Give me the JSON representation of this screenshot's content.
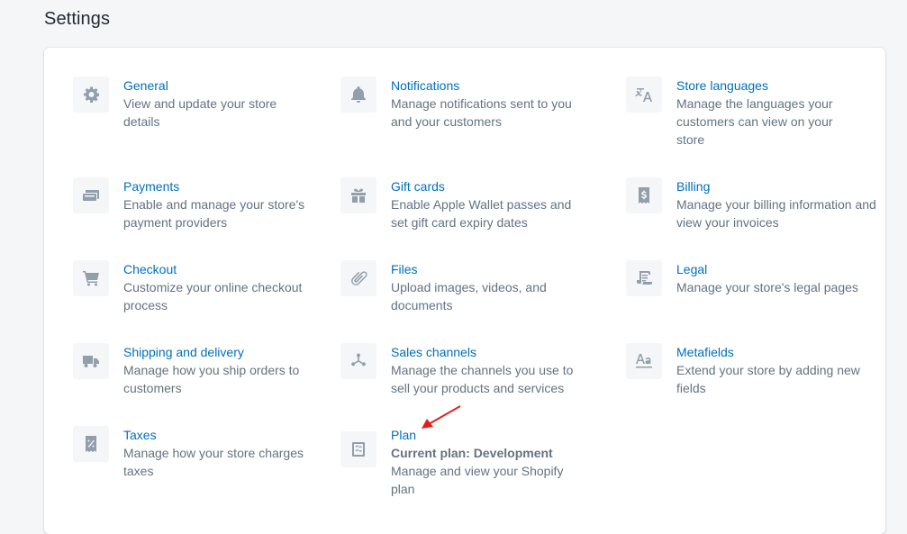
{
  "page": {
    "title": "Settings"
  },
  "settings": {
    "general": {
      "title": "General",
      "desc": "View and update your store details"
    },
    "notifications": {
      "title": "Notifications",
      "desc": "Manage notifications sent to you and your customers"
    },
    "store_languages": {
      "title": "Store languages",
      "desc": "Manage the languages your customers can view on your store"
    },
    "payments": {
      "title": "Payments",
      "desc": "Enable and manage your store's payment providers"
    },
    "gift_cards": {
      "title": "Gift cards",
      "desc": "Enable Apple Wallet passes and set gift card expiry dates"
    },
    "billing": {
      "title": "Billing",
      "desc": "Manage your billing information and view your invoices"
    },
    "checkout": {
      "title": "Checkout",
      "desc": "Customize your online checkout process"
    },
    "files": {
      "title": "Files",
      "desc": "Upload images, videos, and documents"
    },
    "legal": {
      "title": "Legal",
      "desc": "Manage your store's legal pages"
    },
    "shipping": {
      "title": "Shipping and delivery",
      "desc": "Manage how you ship orders to customers"
    },
    "sales_channels": {
      "title": "Sales channels",
      "desc": "Manage the channels you use to sell your products and services"
    },
    "metafields": {
      "title": "Metafields",
      "desc": "Extend your store by adding new fields"
    },
    "taxes": {
      "title": "Taxes",
      "desc": "Manage how your store charges taxes"
    },
    "plan": {
      "title": "Plan",
      "subtitle": "Current plan: Development",
      "desc": "Manage and view your Shopify plan"
    }
  },
  "colors": {
    "link": "#006fbb",
    "text_muted": "#637381",
    "icon": "#919eab",
    "arrow": "#e02020"
  },
  "icons": [
    "gear-icon",
    "bell-icon",
    "translate-icon",
    "credit-card-icon",
    "gift-icon",
    "dollar-receipt-icon",
    "cart-icon",
    "paperclip-icon",
    "legal-document-icon",
    "truck-icon",
    "channels-icon",
    "text-format-icon",
    "tax-receipt-icon",
    "plan-checklist-icon"
  ]
}
